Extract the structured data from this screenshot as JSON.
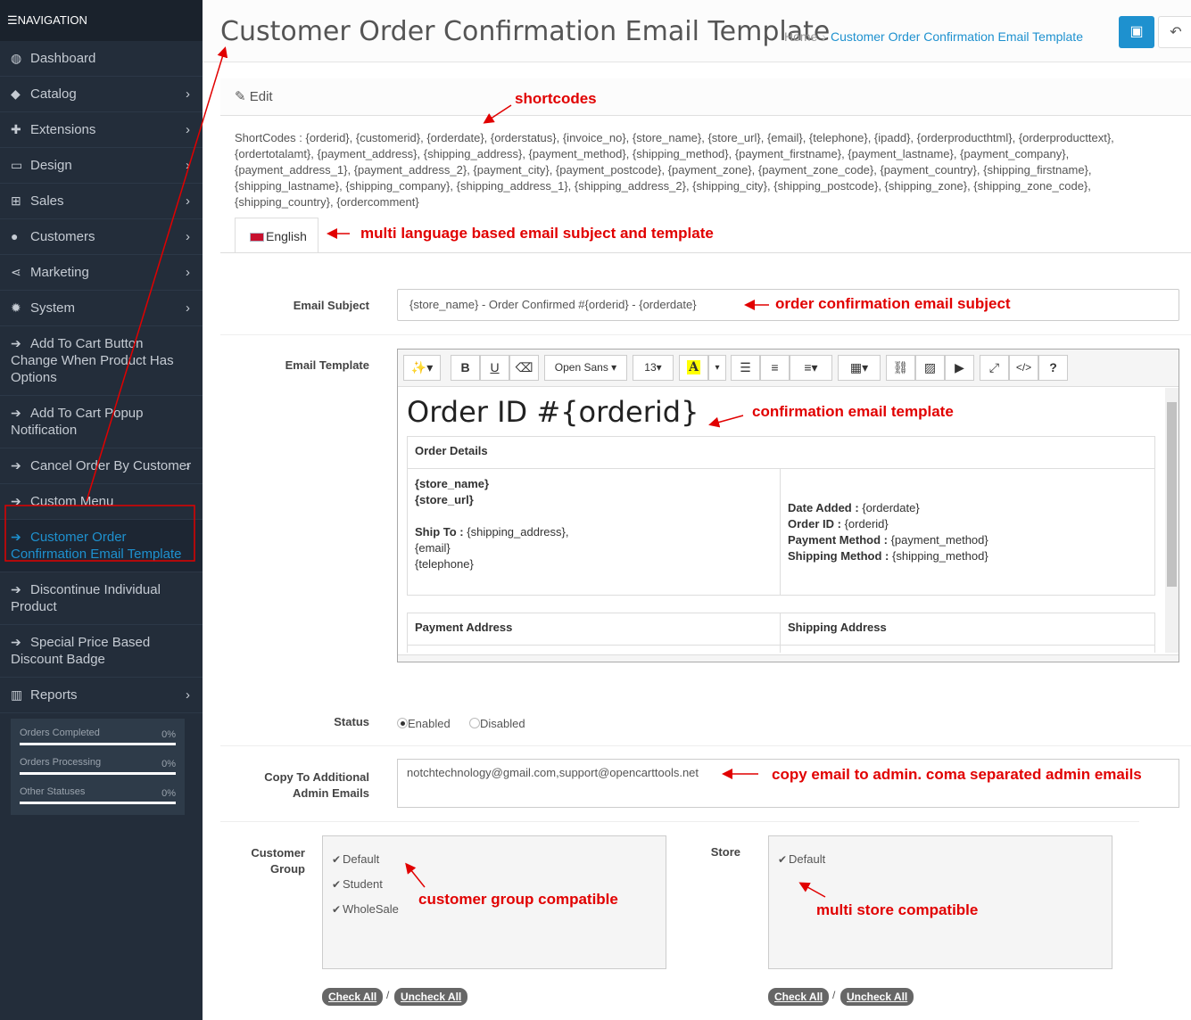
{
  "sidebar": {
    "title": "NAVIGATION",
    "items": [
      {
        "label": "Dashboard",
        "icon": "dashboard-icon",
        "glyph": "◍",
        "chevron": false
      },
      {
        "label": "Catalog",
        "icon": "tag-icon",
        "glyph": "◆",
        "chevron": true
      },
      {
        "label": "Extensions",
        "icon": "puzzle-icon",
        "glyph": "✚",
        "chevron": true
      },
      {
        "label": "Design",
        "icon": "monitor-icon",
        "glyph": "▭",
        "chevron": true
      },
      {
        "label": "Sales",
        "icon": "cart-icon",
        "glyph": "⊞",
        "chevron": true
      },
      {
        "label": "Customers",
        "icon": "user-icon",
        "glyph": "●",
        "chevron": true
      },
      {
        "label": "Marketing",
        "icon": "share-icon",
        "glyph": "⋖",
        "chevron": true
      },
      {
        "label": "System",
        "icon": "cog-icon",
        "glyph": "✹",
        "chevron": true
      },
      {
        "label": "Add To Cart Button Change When Product Has Options",
        "icon": "arrow-right-icon",
        "glyph": "➔",
        "chevron": false
      },
      {
        "label": "Add To Cart Popup Notification",
        "icon": "arrow-right-icon",
        "glyph": "➔",
        "chevron": false
      },
      {
        "label": "Cancel Order By Customer",
        "icon": "arrow-right-icon",
        "glyph": "➔",
        "chevron": true
      },
      {
        "label": "Custom Menu",
        "icon": "arrow-right-icon",
        "glyph": "➔",
        "chevron": false
      },
      {
        "label": "Customer Order Confirmation Email Template",
        "icon": "arrow-right-icon",
        "glyph": "➔",
        "chevron": false,
        "active": true
      },
      {
        "label": "Discontinue Individual Product",
        "icon": "arrow-right-icon",
        "glyph": "➔",
        "chevron": false
      },
      {
        "label": "Special Price Based Discount Badge",
        "icon": "arrow-right-icon",
        "glyph": "➔",
        "chevron": false
      },
      {
        "label": "Reports",
        "icon": "bar-chart-icon",
        "glyph": "▥",
        "chevron": true
      }
    ],
    "stats": [
      {
        "label": "Orders Completed",
        "value": "0%"
      },
      {
        "label": "Orders Processing",
        "value": "0%"
      },
      {
        "label": "Other Statuses",
        "value": "0%"
      }
    ]
  },
  "header": {
    "title": "Customer Order Confirmation Email Template",
    "breadcrumb_home": "Home",
    "breadcrumb_sep": "›",
    "breadcrumb_current": "Customer Order Confirmation Email Template",
    "save_icon": "save-icon",
    "back_icon": "reply-icon"
  },
  "panel": {
    "edit_label": "Edit",
    "shortcodes": "ShortCodes : {orderid}, {customerid}, {orderdate}, {orderstatus}, {invoice_no}, {store_name}, {store_url}, {email}, {telephone}, {ipadd}, {orderproducthtml}, {orderproducttext}, {ordertotalamt}, {payment_address}, {shipping_address}, {payment_method}, {shipping_method}, {payment_firstname}, {payment_lastname}, {payment_company}, {payment_address_1}, {payment_address_2}, {payment_city}, {payment_postcode}, {payment_zone}, {payment_zone_code}, {payment_country}, {shipping_firstname}, {shipping_lastname}, {shipping_company}, {shipping_address_1}, {shipping_address_2}, {shipping_city}, {shipping_postcode}, {shipping_zone}, {shipping_zone_code}, {shipping_country}, {ordercomment}",
    "language_tab": "English"
  },
  "form": {
    "subject_label": "Email Subject",
    "subject_value": "{store_name} - Order Confirmed #{orderid} - {orderdate}",
    "template_label": "Email Template",
    "status_label": "Status",
    "status_enabled": "Enabled",
    "status_disabled": "Disabled",
    "emails_label_1": "Copy To Additional",
    "emails_label_2": "Admin Emails",
    "emails_value": "notchtechnology@gmail.com,support@opencarttools.net",
    "customer_group_label_1": "Customer",
    "customer_group_label_2": "Group",
    "customer_groups": [
      "Default",
      "Student",
      "WholeSale"
    ],
    "store_label": "Store",
    "stores": [
      "Default"
    ],
    "check_all": "Check All",
    "uncheck_all": "Uncheck All",
    "slash": "/"
  },
  "editor": {
    "font_name": "Open Sans",
    "font_size": "13",
    "heading": "Order ID #{orderid}",
    "order_details_header": "Order Details",
    "store_name": "{store_name}",
    "store_url": "{store_url}",
    "ship_to_label": "Ship To :",
    "ship_to_value": "{shipping_address},",
    "email": "{email}",
    "telephone": "{telephone}",
    "date_added_label": "Date Added :",
    "date_added_value": "{orderdate}",
    "order_id_label": "Order ID :",
    "order_id_value": "{orderid}",
    "payment_method_label": "Payment Method :",
    "payment_method_value": "{payment_method}",
    "shipping_method_label": "Shipping Method :",
    "shipping_method_value": "{shipping_method}",
    "payment_address_header": "Payment Address",
    "shipping_address_header": "Shipping Address"
  },
  "annotations": {
    "shortcodes": "shortcodes",
    "language": "multi language based email subject and template",
    "subject": "order confirmation email subject",
    "template": "confirmation email template",
    "emails": "copy email to admin. coma separated admin emails",
    "group": "customer group compatible",
    "store": "multi store compatible",
    "color": "#e10000"
  }
}
